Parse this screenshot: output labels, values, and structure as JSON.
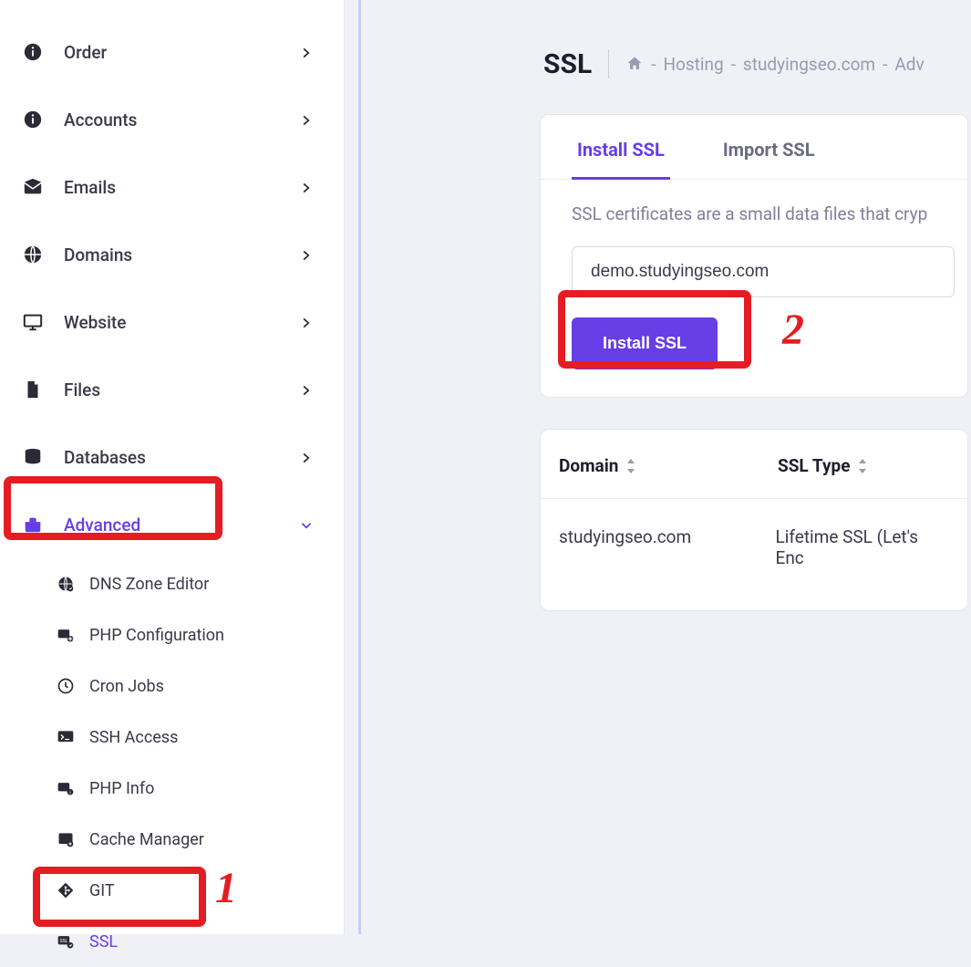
{
  "sidebar": {
    "items": [
      {
        "label": "Order"
      },
      {
        "label": "Accounts"
      },
      {
        "label": "Emails"
      },
      {
        "label": "Domains"
      },
      {
        "label": "Website"
      },
      {
        "label": "Files"
      },
      {
        "label": "Databases"
      },
      {
        "label": "Advanced"
      }
    ],
    "advanced_children": [
      {
        "label": "DNS Zone Editor"
      },
      {
        "label": "PHP Configuration"
      },
      {
        "label": "Cron Jobs"
      },
      {
        "label": "SSH Access"
      },
      {
        "label": "PHP Info"
      },
      {
        "label": "Cache Manager"
      },
      {
        "label": "GIT"
      },
      {
        "label": "SSL"
      }
    ]
  },
  "page": {
    "title": "SSL",
    "breadcrumbs": [
      "Hosting",
      "studyingseo.com",
      "Adv"
    ]
  },
  "tabs": {
    "install": "Install SSL",
    "import": "Import SSL"
  },
  "panel": {
    "description": "SSL certificates are a small data files that cryp",
    "domain_value": "demo.studyingseo.com",
    "button_label": "Install SSL"
  },
  "table": {
    "col_domain": "Domain",
    "col_type": "SSL Type",
    "rows": [
      {
        "domain": "studyingseo.com",
        "type": "Lifetime SSL (Let's Enc"
      }
    ]
  },
  "annotations": {
    "one": "1",
    "two": "2"
  },
  "colors": {
    "accent": "#673de6",
    "annotation": "#e51c23"
  }
}
